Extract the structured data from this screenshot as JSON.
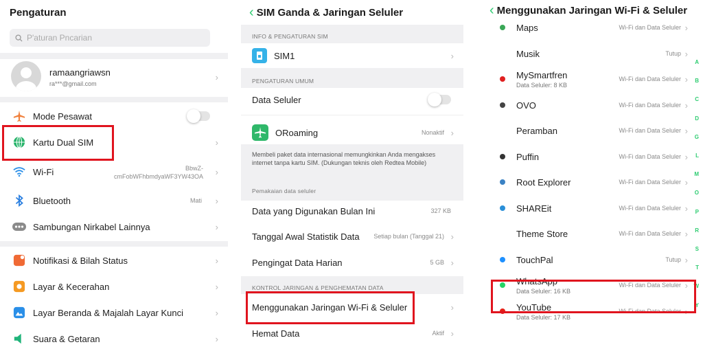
{
  "panel1": {
    "title": "Pengaturan",
    "search_placeholder": "P'aturan Pncarian",
    "account": {
      "name": "ramaangriawsn",
      "email": "ra***@gmail.com"
    },
    "items": [
      {
        "label": "Mode Pesawat",
        "icon": "airplane-icon"
      },
      {
        "label": "Kartu Dual SIM",
        "icon": "globe-icon"
      },
      {
        "label": "Wi-Fi",
        "value": "BbwZ-\ncmFobWFhbmdyaWF3YW43OA",
        "icon": "wifi-icon"
      },
      {
        "label": "Bluetooth",
        "value": "Mati",
        "icon": "bluetooth-icon"
      },
      {
        "label": "Sambungan Nirkabel Lainnya",
        "icon": "dots-icon"
      },
      {
        "label": "Notifikasi & Bilah Status",
        "icon": "notification-icon"
      },
      {
        "label": "Layar &  Kecerahan",
        "icon": "brightness-icon"
      },
      {
        "label": "Layar Beranda & Majalah Layar Kunci",
        "icon": "home-screen-icon"
      },
      {
        "label": "Suara & Getaran",
        "icon": "speaker-icon"
      }
    ]
  },
  "panel2": {
    "title": "SIM Ganda & Jaringan Seluler",
    "section_sim": "INFO & PENGATURAN SIM",
    "sim1": "SIM1",
    "section_general": "PENGATURAN UMUM",
    "data_seluler": "Data Seluler",
    "oroaming": {
      "label": "ORoaming",
      "value": "Nonaktif"
    },
    "oroaming_desc": "Membeli paket data internasional memungkinkan Anda mengakses internet tanpa kartu SIM. (Dukungan teknis oleh Redtea Mobile)",
    "section_usage": "Pemakaian data seluler",
    "usage_items": [
      {
        "label": "Data yang Digunakan Bulan Ini",
        "value": "327 KB"
      },
      {
        "label": "Tanggal Awal Statistik Data",
        "value": "Setiap bulan (Tanggal 21)"
      },
      {
        "label": "Pengingat Data Harian",
        "value": "5 GB"
      }
    ],
    "section_control": "KONTROL JARINGAN & PENGHEMATAN DATA",
    "control_items": [
      {
        "label": "Menggunakan Jaringan Wi-Fi & Seluler",
        "value": ""
      },
      {
        "label": "Hemat Data",
        "value": "Aktif"
      }
    ]
  },
  "panel3": {
    "title": "Menggunakan Jaringan Wi-Fi & Seluler",
    "apps": [
      {
        "name": "Maps",
        "value": "Wi-Fi dan Data Seluler",
        "sub": "",
        "icon": "maps-icon",
        "color": "#3aa757"
      },
      {
        "name": "Musik",
        "value": "Tutup",
        "sub": "",
        "icon": "",
        "color": ""
      },
      {
        "name": "MySmartfren",
        "value": "Wi-Fi dan Data Seluler",
        "sub": "Data Seluler: 8 KB",
        "icon": "mysmartfren-icon",
        "color": "#e02020"
      },
      {
        "name": "OVO",
        "value": "Wi-Fi dan Data Seluler",
        "sub": "",
        "icon": "ovo-icon",
        "color": "#444444"
      },
      {
        "name": "Peramban",
        "value": "Wi-Fi dan Data Seluler",
        "sub": "",
        "icon": "",
        "color": ""
      },
      {
        "name": "Puffin",
        "value": "Wi-Fi dan Data Seluler",
        "sub": "",
        "icon": "puffin-icon",
        "color": "#333333"
      },
      {
        "name": "Root Explorer",
        "value": "Wi-Fi dan Data Seluler",
        "sub": "",
        "icon": "root-explorer-icon",
        "color": "#3b82c4"
      },
      {
        "name": "SHAREit",
        "value": "Wi-Fi dan Data Seluler",
        "sub": "",
        "icon": "shareit-icon",
        "color": "#2a8fd8"
      },
      {
        "name": "Theme Store",
        "value": "Wi-Fi dan Data Seluler",
        "sub": "",
        "icon": "",
        "color": ""
      },
      {
        "name": "TouchPal",
        "value": "Tutup",
        "sub": "",
        "icon": "touchpal-icon",
        "color": "#1e90ff"
      },
      {
        "name": "WhatsApp",
        "value": "Wi-Fi dan Data Seluler",
        "sub": "Data Seluler: 16 KB",
        "icon": "whatsapp-icon",
        "color": "#25d366"
      },
      {
        "name": "YouTube",
        "value": "Wi-Fi dan Data Seluler",
        "sub": "Data Seluler: 17 KB",
        "icon": "youtube-icon",
        "color": "#e62117"
      }
    ],
    "alphabet": [
      "A",
      "B",
      "C",
      "D",
      "G",
      "L",
      "M",
      "O",
      "P",
      "R",
      "S",
      "T",
      "W",
      "Y"
    ]
  },
  "colors": {
    "accent": "#2ecc71",
    "highlight": "#e0141e"
  }
}
